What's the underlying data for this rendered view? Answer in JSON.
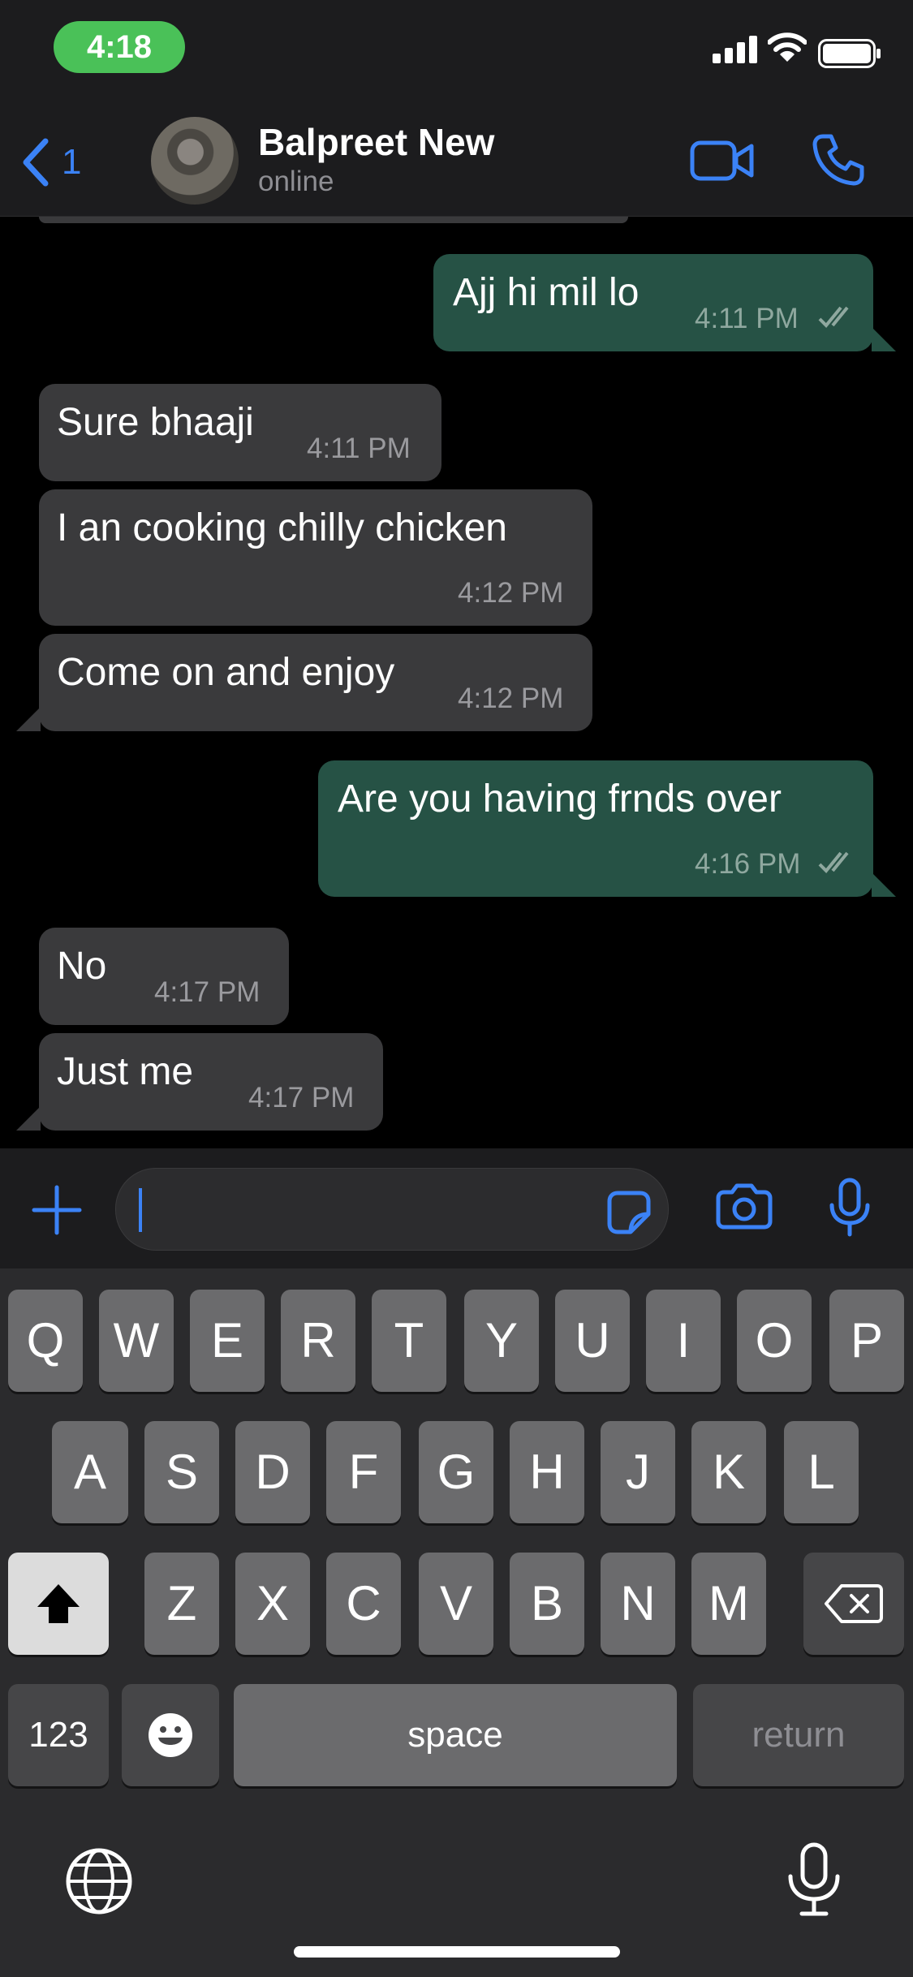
{
  "status_bar": {
    "time": "4:18"
  },
  "header": {
    "back_count": "1",
    "contact_name": "Balpreet New",
    "contact_status": "online"
  },
  "messages": [
    {
      "direction": "out",
      "text": "Ajj hi mil lo",
      "time": "4:11 PM",
      "read": true
    },
    {
      "direction": "in",
      "text": "Sure bhaaji",
      "time": "4:11 PM"
    },
    {
      "direction": "in",
      "text": "I an cooking chilly chicken",
      "time": "4:12 PM"
    },
    {
      "direction": "in",
      "text": "Come on and enjoy",
      "time": "4:12 PM"
    },
    {
      "direction": "out",
      "text": "Are you having frnds over",
      "time": "4:16 PM",
      "read": true
    },
    {
      "direction": "in",
      "text": "No",
      "time": "4:17 PM"
    },
    {
      "direction": "in",
      "text": "Just me",
      "time": "4:17 PM"
    }
  ],
  "composer": {
    "value": ""
  },
  "keyboard": {
    "row1": [
      "Q",
      "W",
      "E",
      "R",
      "T",
      "Y",
      "U",
      "I",
      "O",
      "P"
    ],
    "row2": [
      "A",
      "S",
      "D",
      "F",
      "G",
      "H",
      "J",
      "K",
      "L"
    ],
    "row3": [
      "Z",
      "X",
      "C",
      "V",
      "B",
      "N",
      "M"
    ],
    "numbers_label": "123",
    "space_label": "space",
    "return_label": "return"
  },
  "colors": {
    "accent": "#3b82f6",
    "outgoing_bubble": "#265245",
    "incoming_bubble": "#3a3a3c",
    "time_pill": "#4ac158"
  },
  "icons": [
    "back-chevron-icon",
    "video-call-icon",
    "phone-icon",
    "plus-icon",
    "sticker-icon",
    "camera-icon",
    "microphone-icon",
    "shift-icon",
    "backspace-icon",
    "emoji-icon",
    "globe-icon",
    "dictation-icon",
    "read-receipt-icon",
    "signal-icon",
    "wifi-icon",
    "battery-icon"
  ]
}
